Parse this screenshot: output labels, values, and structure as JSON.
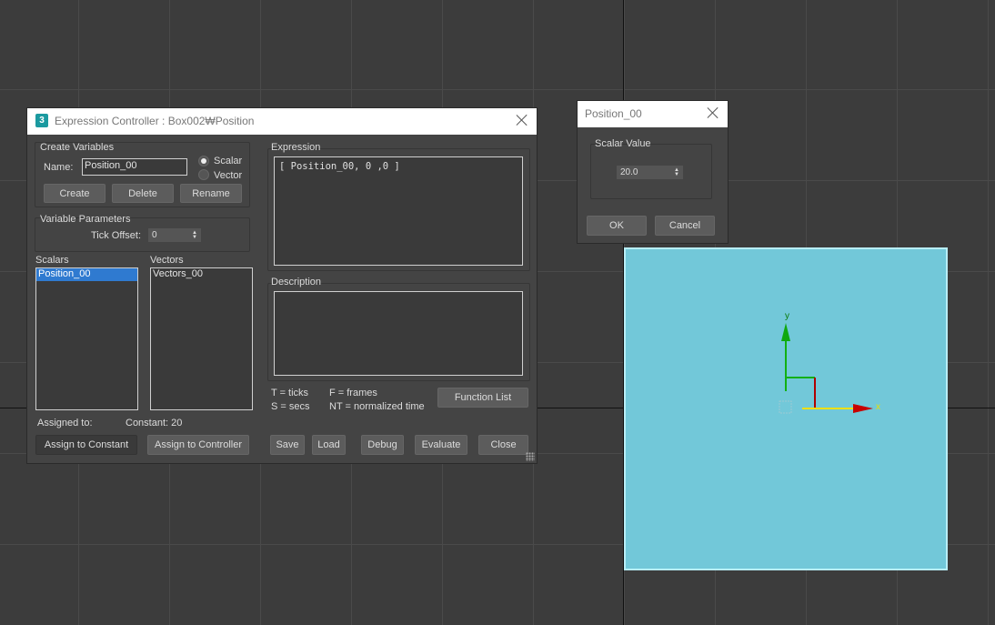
{
  "expression_dialog": {
    "title": "Expression Controller : Box002₩Position",
    "create_variables": {
      "group_label": "Create Variables",
      "name_label": "Name:",
      "name_value": "Position_00",
      "scalar_label": "Scalar",
      "vector_label": "Vector",
      "selected_type": "Scalar",
      "create_button": "Create",
      "delete_button": "Delete",
      "rename_button": "Rename"
    },
    "variable_parameters": {
      "group_label": "Variable Parameters",
      "tick_offset_label": "Tick Offset:",
      "tick_offset_value": "0"
    },
    "scalars": {
      "label": "Scalars",
      "items": [
        "Position_00"
      ],
      "selected": "Position_00"
    },
    "vectors": {
      "label": "Vectors",
      "items": [
        "Vectors_00"
      ]
    },
    "assigned": {
      "label": "Assigned to:",
      "value": "Constant: 20"
    },
    "assign_constant_button": "Assign to Constant",
    "assign_controller_button": "Assign to Controller",
    "expression": {
      "label": "Expression",
      "text": "[ Position_00, 0 ,0 ]"
    },
    "description": {
      "label": "Description",
      "text": ""
    },
    "legend": {
      "ticks": "T = ticks",
      "frames": "F = frames",
      "secs": "S = secs",
      "normalized": "NT = normalized time"
    },
    "function_list_button": "Function List",
    "bottom_buttons": {
      "save": "Save",
      "load": "Load",
      "debug": "Debug",
      "evaluate": "Evaluate",
      "close": "Close"
    }
  },
  "scalar_dialog": {
    "title": "Position_00",
    "group_label": "Scalar Value",
    "value": "20.0",
    "ok_button": "OK",
    "cancel_button": "Cancel"
  },
  "viewport": {
    "box_color": "#72c8d9",
    "gizmo": {
      "y_label": "y",
      "x_label": "x"
    }
  }
}
